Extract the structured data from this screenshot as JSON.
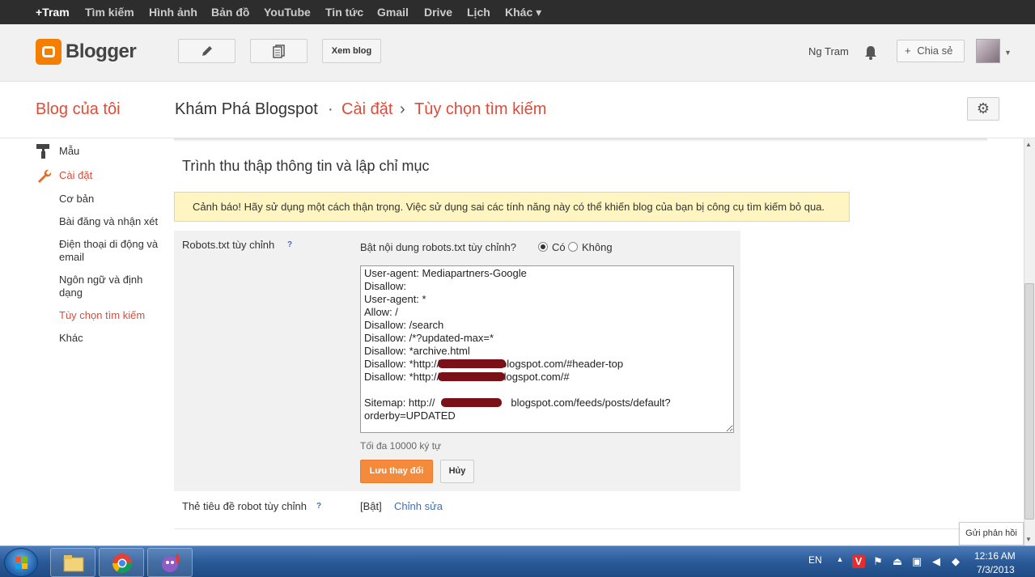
{
  "google_bar": {
    "items": [
      "+Tram",
      "Tìm kiếm",
      "Hình ảnh",
      "Bản đồ",
      "YouTube",
      "Tin tức",
      "Gmail",
      "Drive",
      "Lịch",
      "Khác ▾"
    ]
  },
  "header": {
    "logo_text": "Blogger",
    "view_blog_label": "Xem blog",
    "user_name": "Ng Tram",
    "share_label": "Chia sẻ",
    "share_plus": "+"
  },
  "titlebar": {
    "my_blogs": "Blog của tôi",
    "blog_name": "Khám Phá Blogspot",
    "sep1": "·",
    "settings": "Cài đặt",
    "sep2": "›",
    "search_prefs": "Tùy chọn tìm kiếm"
  },
  "sidebar": {
    "template": "Mẫu",
    "settings": "Cài đặt",
    "sub": [
      "Cơ bản",
      "Bài đăng và nhận xét",
      "Điện thoại di động và email",
      "Ngôn ngữ và định dạng",
      "Tùy chọn tìm kiếm",
      "Khác"
    ]
  },
  "content": {
    "section_title": "Trình thu thập thông tin và lập chỉ mục",
    "warning": "Cảnh báo! Hãy sử dụng một cách thận trọng. Việc sử dụng sai các tính năng này có thể khiến blog của bạn bị công cụ tìm kiếm bỏ qua.",
    "robots_label": "Robots.txt tùy chỉnh",
    "help_mark": "?",
    "enable_question": "Bật nội dung robots.txt tùy chỉnh?",
    "radio_yes": "Có",
    "radio_no": "Không",
    "robots_text": "User-agent: Mediapartners-Google\nDisallow: \nUser-agent: *\nAllow: /\nDisallow: /search\nDisallow: /*?updated-max=*\nDisallow: *archive.html\nDisallow: *http://                    .blogspot.com/#header-top\nDisallow: *http://                   .blogspot.com/#\n\nSitemap: http://                          blogspot.com/feeds/posts/default?\norderby=UPDATED",
    "max_chars": "Tối đa 10000 ký tự",
    "save_label": "Lưu thay đổi",
    "cancel_label": "Hủy",
    "header_tags_label": "Thẻ tiêu đề robot tùy chỉnh",
    "header_tags_value": "[Bật]",
    "edit_label": "Chỉnh sửa"
  },
  "feedback_label": "Gửi phản hồi",
  "taskbar": {
    "lang": "EN",
    "time": "12:16 AM",
    "date": "7/3/2013"
  },
  "colors": {
    "accent": "#dd4b39",
    "blogger_orange": "#f57d00",
    "button_orange": "#f48a3c",
    "link": "#3d6dc4",
    "warning_bg": "#fff5c2"
  }
}
